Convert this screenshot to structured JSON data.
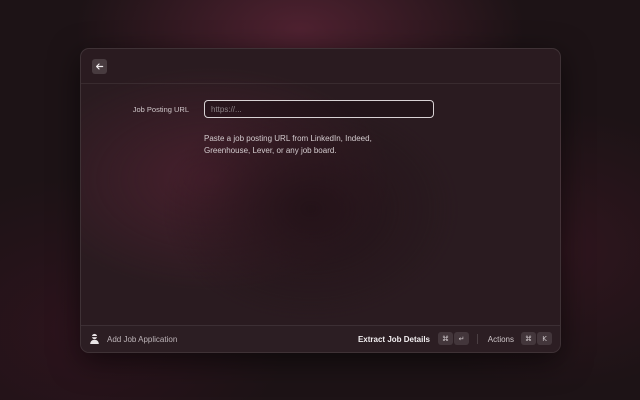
{
  "form": {
    "field_label": "Job Posting URL",
    "url_placeholder": "https://...",
    "url_value": "",
    "hint_line1": "Paste a job posting URL from LinkedIn, Indeed,",
    "hint_line2": "Greenhouse, Lever, or any job board."
  },
  "footer": {
    "app_name": "Add Job Application",
    "app_icon": "extension-icon",
    "primary_action": "Extract Job Details",
    "primary_shortcut": [
      "⌘",
      "↵"
    ],
    "actions_label": "Actions",
    "actions_shortcut": [
      "⌘",
      "K"
    ]
  },
  "toolbar": {
    "back_icon": "arrow-left-icon"
  }
}
